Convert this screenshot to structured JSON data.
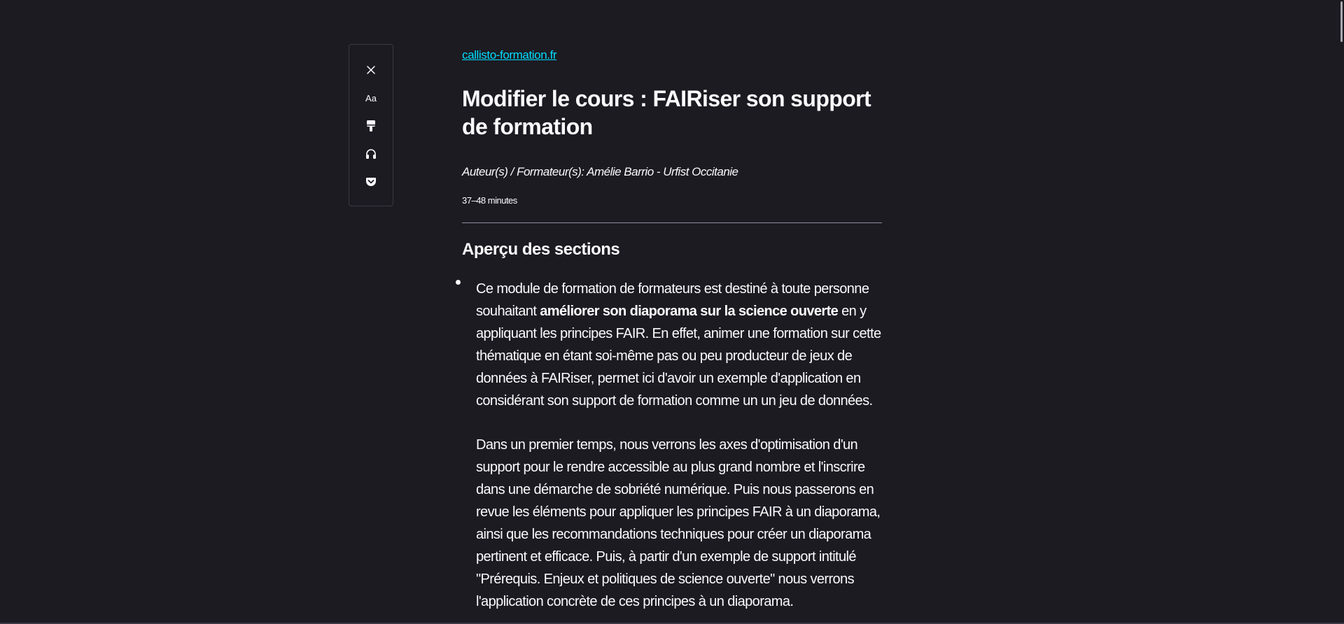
{
  "toolbar": {
    "buttons": [
      {
        "name": "close",
        "icon": "close-icon"
      },
      {
        "name": "text-and-layout",
        "icon": "text-size-icon",
        "label": "Aa"
      },
      {
        "name": "theme",
        "icon": "paint-brush-icon"
      },
      {
        "name": "narrate",
        "icon": "headphones-icon"
      },
      {
        "name": "save-to-pocket",
        "icon": "pocket-icon"
      }
    ]
  },
  "article": {
    "domain": "callisto-formation.fr",
    "title": "Modifier le cours : FAIRiser son support de formation",
    "credits": "Auteur(s) / Formateur(s): Amélie Barrio - Urfist Occitanie",
    "reading_time": "37–48 minutes",
    "section_heading": "Aperçu des sections",
    "paragraph1": {
      "line1": "Ce module de formation de formateurs est destiné à toute personne",
      "line2_pre": "souhaitant ",
      "line2_bold": "améliorer son diaporama sur la science ouverte",
      "line2_post": " en y",
      "line3": "appliquant les principes FAIR. En effet, animer une formation sur cette",
      "line4": "thématique en étant soi-même pas ou peu producteur de jeux de",
      "line5": "données à FAIRiser, permet ici d'avoir un exemple d'application en",
      "line6": "considérant son support de formation comme un un jeu de données."
    },
    "paragraph2": {
      "line1": "Dans un premier temps, nous verrons les axes d'optimisation d'un",
      "line2": "support pour le rendre accessible au plus grand nombre et l'inscrire",
      "line3": "dans une démarche de sobriété numérique. Puis nous passerons en",
      "line4": "revue les éléments pour appliquer les principes FAIR à un diaporama,",
      "line5": "ainsi que les recommandations techniques pour créer un diaporama",
      "line6": "pertinent et efficace. Puis, à partir d'un exemple de support intitulé",
      "line7": "\"Prérequis. Enjeux et politiques de science ouverte\" nous verrons",
      "line8": "l'application concrète de ces principes à un diaporama."
    }
  },
  "colors": {
    "background": "#1c1b22",
    "text": "#fbfbfe",
    "link": "#00ddff",
    "divider": "#8f8f9d"
  }
}
